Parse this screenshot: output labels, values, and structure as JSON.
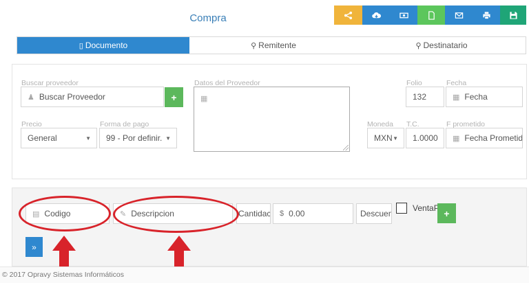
{
  "header": {
    "title": "Compra"
  },
  "toolbar": {
    "buttons": [
      {
        "icon": "share-nodes-icon",
        "color": "#f0b43b"
      },
      {
        "icon": "cloud-download-icon",
        "color": "#2f88cf"
      },
      {
        "icon": "money-icon",
        "color": "#2f88cf"
      },
      {
        "icon": "file-icon",
        "color": "#5cc65c"
      },
      {
        "icon": "envelope-icon",
        "color": "#2f88cf"
      },
      {
        "icon": "print-icon",
        "color": "#2f88cf"
      },
      {
        "icon": "save-icon",
        "color": "#1fa577"
      }
    ]
  },
  "tabs": [
    {
      "label": "Documento",
      "active": true
    },
    {
      "label": "Remitente",
      "active": false
    },
    {
      "label": "Destinatario",
      "active": false
    }
  ],
  "form": {
    "buscar_proveedor": {
      "label": "Buscar proveedor",
      "placeholder": "Buscar Proveedor"
    },
    "datos_proveedor": {
      "label": "Datos del Proveedor"
    },
    "folio": {
      "label": "Folio",
      "value": "132"
    },
    "fecha": {
      "label": "Fecha",
      "placeholder": "Fecha"
    },
    "precio": {
      "label": "Precio",
      "value": "General"
    },
    "forma_pago": {
      "label": "Forma de pago",
      "value": "99 - Por definir."
    },
    "moneda": {
      "label": "Moneda",
      "value": "MXN"
    },
    "tc": {
      "label": "T.C.",
      "value": "1.0000"
    },
    "f_prometido": {
      "label": "F prometido",
      "placeholder": "Fecha Prometido"
    }
  },
  "line_entry": {
    "codigo": "Codigo",
    "descripcion": "Descripcion",
    "cantidad": "Cantidac",
    "precio_symbol": "$",
    "precio_value": "0.00",
    "descuento": "Descuen",
    "venta_label": "VentaPo",
    "go_label": "»"
  },
  "annotations": {
    "color": "#d8232a"
  },
  "footer": {
    "text": "© 2017 Opravy Sistemas Informáticos"
  }
}
